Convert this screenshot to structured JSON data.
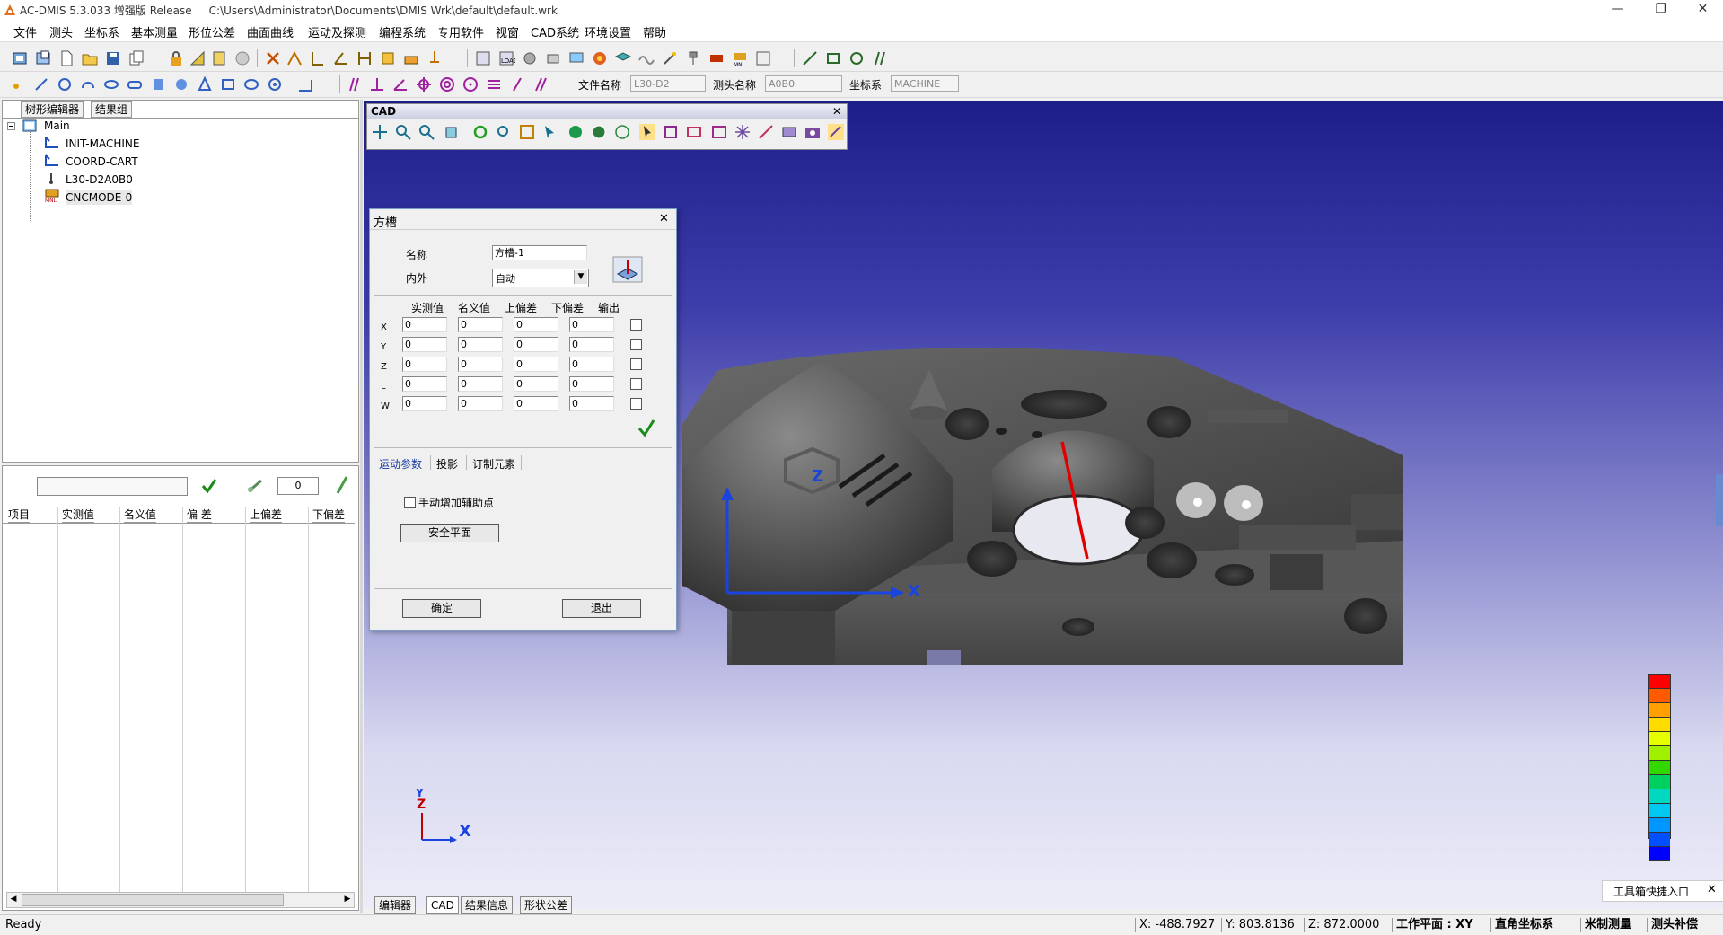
{
  "window": {
    "title": "AC-DMIS 5.3.033 增强版 Release     C:\\Users\\Administrator\\Documents\\DMIS Wrk\\default\\default.wrk",
    "minimize": "—",
    "restore": "❐",
    "close": "✕"
  },
  "menu": [
    "文件",
    "测头",
    "坐标系",
    "基本测量",
    "形位公差",
    "曲面曲线",
    "运动及探测",
    "编程系统",
    "专用软件",
    "视窗",
    "CAD系统",
    "环境设置",
    "帮助"
  ],
  "toolbar": {
    "file_label": "文件名称",
    "file_value": "L30-D2",
    "probe_label": "测头名称",
    "probe_value": "A0B0",
    "coord_label": "坐标系",
    "coord_value": "MACHINE"
  },
  "tree": {
    "tabs": [
      "树形编辑器",
      "结果组"
    ],
    "root": "Main",
    "nodes": [
      "INIT-MACHINE",
      "COORD-CART",
      "L30-D2A0B0",
      "CNCMODE-0"
    ]
  },
  "results": {
    "counter": "0",
    "columns": [
      "项目",
      "实测值",
      "名义值",
      "偏 差",
      "上偏差",
      "下偏差"
    ]
  },
  "cad_toolbar": {
    "title": "CAD",
    "close": "✕"
  },
  "dialog": {
    "title": "方槽",
    "close": "✕",
    "name_label": "名称",
    "name_value": "方槽-1",
    "inout_label": "内外",
    "inout_value": "自动",
    "columns": [
      "实测值",
      "名义值",
      "上偏差",
      "下偏差",
      "输出"
    ],
    "rows": [
      {
        "axis": "X",
        "values": [
          "0",
          "0",
          "0",
          "0"
        ]
      },
      {
        "axis": "Y",
        "values": [
          "0",
          "0",
          "0",
          "0"
        ]
      },
      {
        "axis": "Z",
        "values": [
          "0",
          "0",
          "0",
          "0"
        ]
      },
      {
        "axis": "L",
        "values": [
          "0",
          "0",
          "0",
          "0"
        ]
      },
      {
        "axis": "W",
        "values": [
          "0",
          "0",
          "0",
          "0"
        ]
      }
    ],
    "tabs": [
      "运动参数",
      "投影",
      "订制元素"
    ],
    "manual_aux_label": "手动增加辅助点",
    "safe_plane_button": "安全平面",
    "ok_button": "确定",
    "exit_button": "退出"
  },
  "viewport": {
    "axis_x": "X",
    "axis_z": "Z",
    "tri_x": "X",
    "tri_z": "Z",
    "tri_y": "Y",
    "legend_colors": [
      "#ff0000",
      "#ff5a00",
      "#ffa000",
      "#ffdc00",
      "#e6ff00",
      "#a0f000",
      "#30d800",
      "#00d060",
      "#00d8c0",
      "#00c8f0",
      "#0096ff",
      "#0050ff",
      "#0000ff"
    ]
  },
  "toolbox_entry": {
    "label": "工具箱快捷入口",
    "close": "✕"
  },
  "bottom_tabs": [
    "编辑器",
    "CAD",
    "结果信息",
    "形状公差"
  ],
  "status": {
    "ready": "Ready",
    "x": "X: -488.7927",
    "y": "Y: 803.8136",
    "z": "Z: 872.0000",
    "workplane": "工作平面 : XY",
    "coord_system": "直角坐标系",
    "measure_mode": "米制测量",
    "probe_comp": "测头补偿"
  },
  "colors": {
    "accent": "#316ac5",
    "probe_line": "#e00000",
    "axis_blue": "#1a44e0"
  }
}
